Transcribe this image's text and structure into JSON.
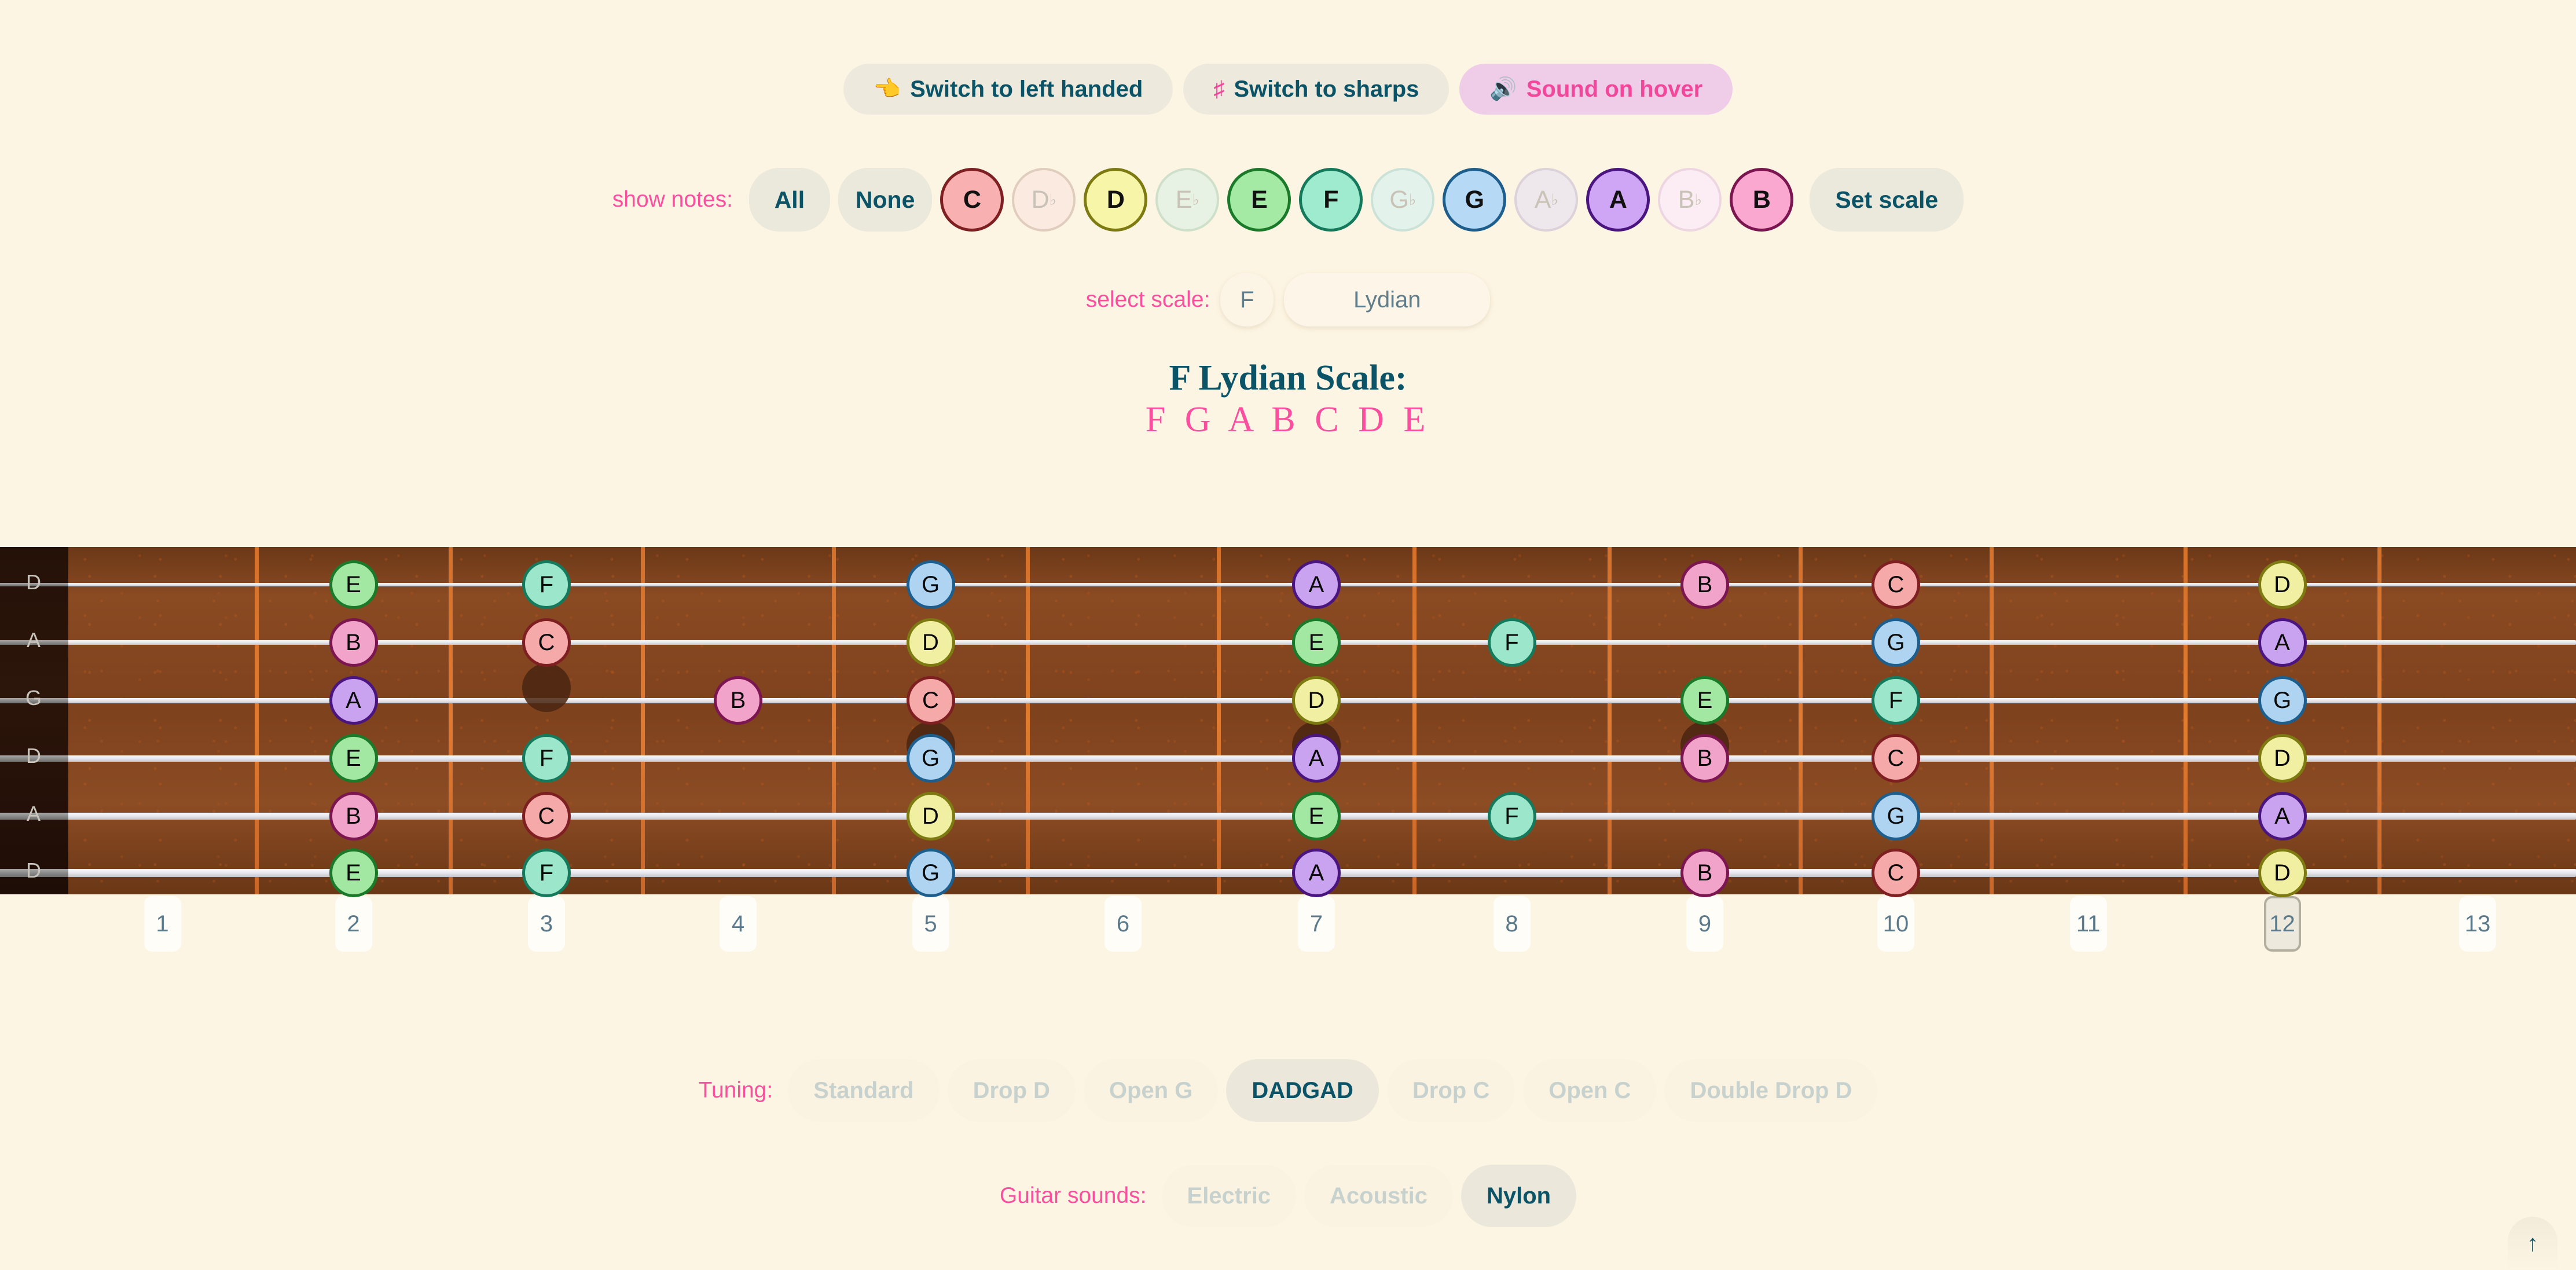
{
  "toolbar": {
    "left_handed": {
      "icon": "pointing-hand-icon",
      "glyph": "👈",
      "label": "Switch to left handed"
    },
    "sharps": {
      "icon": "sharp-sign-icon",
      "glyph": "♯",
      "label": "Switch to sharps"
    },
    "sound_hover": {
      "icon": "speaker-icon",
      "glyph": "🔊",
      "label": "Sound on hover",
      "active": true
    }
  },
  "show_notes": {
    "label": "show notes:",
    "all_label": "All",
    "none_label": "None",
    "set_scale_label": "Set scale",
    "notes": [
      {
        "name": "C",
        "accidental": "",
        "on": true,
        "fill": "#F8B0B0",
        "border": "#7E1F22"
      },
      {
        "name": "D",
        "accidental": "♭",
        "on": false,
        "fill": "#FAEAE0",
        "border": "#E0CDBE"
      },
      {
        "name": "D",
        "accidental": "",
        "on": true,
        "fill": "#F6F5A8",
        "border": "#7C7A10"
      },
      {
        "name": "E",
        "accidental": "♭",
        "on": false,
        "fill": "#E8F2E4",
        "border": "#CFE0CA"
      },
      {
        "name": "E",
        "accidental": "",
        "on": true,
        "fill": "#A4EAA4",
        "border": "#1B7A2A"
      },
      {
        "name": "F",
        "accidental": "",
        "on": true,
        "fill": "#9EEBD0",
        "border": "#157A5C"
      },
      {
        "name": "G",
        "accidental": "♭",
        "on": false,
        "fill": "#E4F2EC",
        "border": "#CBE2D8"
      },
      {
        "name": "G",
        "accidental": "",
        "on": true,
        "fill": "#B6D9F6",
        "border": "#1E5E8C"
      },
      {
        "name": "A",
        "accidental": "♭",
        "on": false,
        "fill": "#EEE7EC",
        "border": "#DCD2DA"
      },
      {
        "name": "A",
        "accidental": "",
        "on": true,
        "fill": "#CFA6F5",
        "border": "#4B1580"
      },
      {
        "name": "B",
        "accidental": "♭",
        "on": false,
        "fill": "#FBEDF3",
        "border": "#EDD6E2"
      },
      {
        "name": "B",
        "accidental": "",
        "on": true,
        "fill": "#FBA8D0",
        "border": "#7C1650"
      }
    ]
  },
  "scale_select": {
    "label": "select scale:",
    "root": "F",
    "mode": "Lydian"
  },
  "scale_title": "F Lydian Scale:",
  "scale_notes": "F G A B C D E",
  "fretboard": {
    "strings": [
      "D",
      "A",
      "G",
      "D",
      "A",
      "D"
    ],
    "fret_numbers": [
      "1",
      "2",
      "3",
      "4",
      "5",
      "6",
      "7",
      "8",
      "9",
      "10",
      "11",
      "12",
      "13"
    ],
    "highlighted_fret": "12",
    "notes": [
      {
        "string": 0,
        "fret": 2,
        "name": "E"
      },
      {
        "string": 0,
        "fret": 3,
        "name": "F"
      },
      {
        "string": 0,
        "fret": 5,
        "name": "G"
      },
      {
        "string": 0,
        "fret": 7,
        "name": "A"
      },
      {
        "string": 0,
        "fret": 9,
        "name": "B"
      },
      {
        "string": 0,
        "fret": 10,
        "name": "C"
      },
      {
        "string": 0,
        "fret": 12,
        "name": "D"
      },
      {
        "string": 1,
        "fret": 2,
        "name": "B"
      },
      {
        "string": 1,
        "fret": 3,
        "name": "C"
      },
      {
        "string": 1,
        "fret": 5,
        "name": "D"
      },
      {
        "string": 1,
        "fret": 7,
        "name": "E"
      },
      {
        "string": 1,
        "fret": 8,
        "name": "F"
      },
      {
        "string": 1,
        "fret": 10,
        "name": "G"
      },
      {
        "string": 1,
        "fret": 12,
        "name": "A"
      },
      {
        "string": 2,
        "fret": 2,
        "name": "A"
      },
      {
        "string": 2,
        "fret": 4,
        "name": "B"
      },
      {
        "string": 2,
        "fret": 5,
        "name": "C"
      },
      {
        "string": 2,
        "fret": 7,
        "name": "D"
      },
      {
        "string": 2,
        "fret": 9,
        "name": "E"
      },
      {
        "string": 2,
        "fret": 10,
        "name": "F"
      },
      {
        "string": 2,
        "fret": 12,
        "name": "G"
      },
      {
        "string": 3,
        "fret": 2,
        "name": "E"
      },
      {
        "string": 3,
        "fret": 3,
        "name": "F"
      },
      {
        "string": 3,
        "fret": 5,
        "name": "G"
      },
      {
        "string": 3,
        "fret": 7,
        "name": "A"
      },
      {
        "string": 3,
        "fret": 9,
        "name": "B"
      },
      {
        "string": 3,
        "fret": 10,
        "name": "C"
      },
      {
        "string": 3,
        "fret": 12,
        "name": "D"
      },
      {
        "string": 4,
        "fret": 2,
        "name": "B"
      },
      {
        "string": 4,
        "fret": 3,
        "name": "C"
      },
      {
        "string": 4,
        "fret": 5,
        "name": "D"
      },
      {
        "string": 4,
        "fret": 7,
        "name": "E"
      },
      {
        "string": 4,
        "fret": 8,
        "name": "F"
      },
      {
        "string": 4,
        "fret": 10,
        "name": "G"
      },
      {
        "string": 4,
        "fret": 12,
        "name": "A"
      },
      {
        "string": 5,
        "fret": 2,
        "name": "E"
      },
      {
        "string": 5,
        "fret": 3,
        "name": "F"
      },
      {
        "string": 5,
        "fret": 5,
        "name": "G"
      },
      {
        "string": 5,
        "fret": 7,
        "name": "A"
      },
      {
        "string": 5,
        "fret": 9,
        "name": "B"
      },
      {
        "string": 5,
        "fret": 10,
        "name": "C"
      },
      {
        "string": 5,
        "fret": 12,
        "name": "D"
      }
    ],
    "shadow_notes": [
      {
        "string": 2,
        "fret": 3
      },
      {
        "string": 3,
        "fret": 5
      },
      {
        "string": 3,
        "fret": 7
      },
      {
        "string": 3,
        "fret": 9
      }
    ],
    "note_colors": {
      "C": {
        "fill": "#F5A9A9",
        "border": "#7E1F22"
      },
      "D": {
        "fill": "#F0EFA2",
        "border": "#7C7A10"
      },
      "E": {
        "fill": "#A2E8A2",
        "border": "#1B7A2A"
      },
      "F": {
        "fill": "#9CE6CB",
        "border": "#157A5C"
      },
      "G": {
        "fill": "#AED4F2",
        "border": "#1E5E8C"
      },
      "A": {
        "fill": "#C9A2F0",
        "border": "#4B1580"
      },
      "B": {
        "fill": "#F2A3C9",
        "border": "#7C1650"
      }
    }
  },
  "tuning": {
    "label": "Tuning:",
    "options": [
      "Standard",
      "Drop D",
      "Open G",
      "DADGAD",
      "Drop C",
      "Open C",
      "Double Drop D"
    ],
    "selected": "DADGAD"
  },
  "sounds": {
    "label": "Guitar sounds:",
    "options": [
      "Electric",
      "Acoustic",
      "Nylon"
    ],
    "selected": "Nylon"
  },
  "scroll_top": {
    "icon": "arrow-up-icon",
    "glyph": "↑"
  }
}
